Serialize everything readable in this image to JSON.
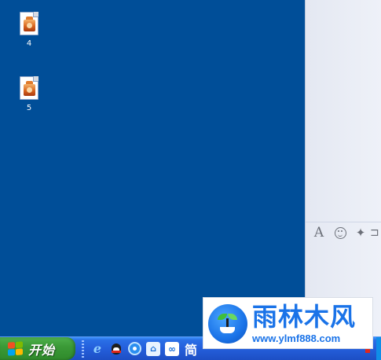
{
  "desktop": {
    "background_color": "#004e98",
    "icons": [
      {
        "label": "4",
        "icon": "image-file-icon"
      },
      {
        "label": "5",
        "icon": "image-file-icon"
      }
    ]
  },
  "side_panel": {
    "toolbar": {
      "font_button_glyph": "A",
      "emoji_icon": "smiley-icon",
      "magic_glyph": "✦",
      "more_glyph": "⊐"
    }
  },
  "taskbar": {
    "start_label": "开始",
    "quick_launch": [
      {
        "name": "ie-icon",
        "glyph": "e"
      },
      {
        "name": "qq-icon",
        "glyph": ""
      },
      {
        "name": "browser-icon",
        "glyph": ""
      },
      {
        "name": "cloud-icon",
        "glyph": "⌂"
      },
      {
        "name": "link-icon",
        "glyph": "∞"
      },
      {
        "name": "text-tool-icon",
        "glyph": "简"
      }
    ]
  },
  "watermark": {
    "title": "雨林木风",
    "url": "www.ylmf888.com"
  },
  "colors": {
    "desktop_blue": "#004e98",
    "taskbar_blue": "#245edb",
    "start_green": "#3b9a37",
    "brand_blue": "#1a73e8"
  }
}
